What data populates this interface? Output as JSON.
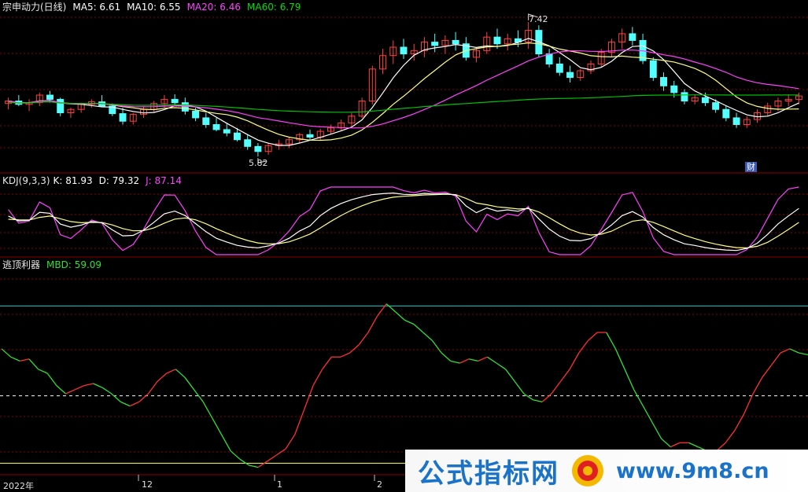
{
  "main_panel": {
    "title": "宗申动力(日线)",
    "ma5_label": "MA5: 6.61",
    "ma10_label": "MA10: 6.55",
    "ma20_label": "MA20: 6.46",
    "ma60_label": "MA60: 6.79",
    "high_marker": "7.42",
    "low_marker": "5.82",
    "finance_badge": "财"
  },
  "kdj_panel": {
    "title": "KDJ(9,3,3)",
    "k_label": "K: 81.93",
    "d_label": "D: 79.32",
    "j_label": "J: 87.14"
  },
  "indicator_panel": {
    "title": "逃顶利器",
    "mbd_label": "MBD: 59.09"
  },
  "x_axis": {
    "labels": [
      "2022年",
      "12",
      "1",
      "2"
    ]
  },
  "watermark": {
    "left_text": "公式指标网",
    "right_text": "www.9m8.cn"
  },
  "colors": {
    "up": "#ff4040",
    "down": "#54ffff",
    "ma5": "#ffffff",
    "ma10": "#ffff80",
    "ma20": "#ff40ff",
    "ma60": "#00c000",
    "mbd_up": "#ff3030",
    "mbd_down": "#30e030",
    "grid": "#8b0000"
  },
  "chart_data": [
    {
      "type": "candlestick",
      "title": "宗申动力(日线)",
      "high_annotation": 7.42,
      "low_annotation": 5.82,
      "ylim": [
        5.7,
        7.55
      ],
      "ohlc": [
        [
          6.45,
          6.52,
          6.38,
          6.48
        ],
        [
          6.48,
          6.55,
          6.42,
          6.44
        ],
        [
          6.44,
          6.5,
          6.36,
          6.46
        ],
        [
          6.46,
          6.58,
          6.42,
          6.55
        ],
        [
          6.55,
          6.6,
          6.46,
          6.5
        ],
        [
          6.5,
          6.52,
          6.3,
          6.34
        ],
        [
          6.34,
          6.4,
          6.28,
          6.38
        ],
        [
          6.38,
          6.46,
          6.34,
          6.44
        ],
        [
          6.44,
          6.5,
          6.4,
          6.47
        ],
        [
          6.47,
          6.55,
          6.41,
          6.42
        ],
        [
          6.42,
          6.45,
          6.3,
          6.33
        ],
        [
          6.33,
          6.4,
          6.2,
          6.24
        ],
        [
          6.24,
          6.34,
          6.2,
          6.32
        ],
        [
          6.32,
          6.42,
          6.28,
          6.38
        ],
        [
          6.38,
          6.48,
          6.34,
          6.45
        ],
        [
          6.45,
          6.55,
          6.4,
          6.5
        ],
        [
          6.5,
          6.56,
          6.42,
          6.46
        ],
        [
          6.46,
          6.52,
          6.32,
          6.36
        ],
        [
          6.36,
          6.4,
          6.24,
          6.28
        ],
        [
          6.28,
          6.34,
          6.16,
          6.2
        ],
        [
          6.2,
          6.28,
          6.12,
          6.14
        ],
        [
          6.14,
          6.22,
          6.06,
          6.1
        ],
        [
          6.1,
          6.16,
          6.0,
          6.02
        ],
        [
          6.02,
          6.08,
          5.9,
          5.94
        ],
        [
          5.94,
          5.98,
          5.82,
          5.88
        ],
        [
          5.88,
          5.98,
          5.84,
          5.95
        ],
        [
          5.95,
          6.02,
          5.9,
          5.97
        ],
        [
          5.97,
          6.05,
          5.92,
          6.02
        ],
        [
          6.02,
          6.1,
          5.98,
          6.08
        ],
        [
          6.08,
          6.14,
          6.02,
          6.05
        ],
        [
          6.05,
          6.15,
          6.02,
          6.12
        ],
        [
          6.12,
          6.2,
          6.08,
          6.16
        ],
        [
          6.16,
          6.26,
          6.12,
          6.22
        ],
        [
          6.22,
          6.34,
          6.18,
          6.3
        ],
        [
          6.3,
          6.52,
          6.28,
          6.48
        ],
        [
          6.48,
          6.9,
          6.44,
          6.86
        ],
        [
          6.86,
          7.1,
          6.8,
          7.02
        ],
        [
          7.02,
          7.2,
          6.92,
          7.12
        ],
        [
          7.12,
          7.22,
          6.98,
          7.04
        ],
        [
          7.04,
          7.16,
          6.96,
          7.08
        ],
        [
          7.08,
          7.24,
          7.0,
          7.18
        ],
        [
          7.18,
          7.28,
          7.06,
          7.14
        ],
        [
          7.14,
          7.26,
          7.04,
          7.2
        ],
        [
          7.2,
          7.3,
          7.08,
          7.16
        ],
        [
          7.16,
          7.24,
          6.96,
          7.0
        ],
        [
          7.0,
          7.12,
          6.94,
          7.08
        ],
        [
          7.08,
          7.3,
          7.04,
          7.24
        ],
        [
          7.24,
          7.34,
          7.1,
          7.16
        ],
        [
          7.16,
          7.28,
          7.08,
          7.22
        ],
        [
          7.22,
          7.32,
          7.12,
          7.18
        ],
        [
          7.18,
          7.42,
          7.1,
          7.32
        ],
        [
          7.32,
          7.38,
          7.0,
          7.04
        ],
        [
          7.04,
          7.1,
          6.88,
          6.92
        ],
        [
          6.92,
          7.0,
          6.78,
          6.82
        ],
        [
          6.82,
          6.9,
          6.7,
          6.76
        ],
        [
          6.76,
          6.86,
          6.72,
          6.84
        ],
        [
          6.84,
          6.96,
          6.8,
          6.92
        ],
        [
          6.92,
          7.1,
          6.88,
          7.06
        ],
        [
          7.06,
          7.22,
          7.0,
          7.18
        ],
        [
          7.18,
          7.34,
          7.1,
          7.28
        ],
        [
          7.28,
          7.36,
          7.14,
          7.2
        ],
        [
          7.2,
          7.28,
          6.92,
          6.96
        ],
        [
          6.96,
          7.0,
          6.72,
          6.76
        ],
        [
          6.76,
          6.82,
          6.6,
          6.66
        ],
        [
          6.66,
          6.72,
          6.52,
          6.58
        ],
        [
          6.58,
          6.62,
          6.44,
          6.48
        ],
        [
          6.48,
          6.56,
          6.44,
          6.52
        ],
        [
          6.52,
          6.58,
          6.42,
          6.46
        ],
        [
          6.46,
          6.5,
          6.34,
          6.38
        ],
        [
          6.38,
          6.42,
          6.24,
          6.28
        ],
        [
          6.28,
          6.34,
          6.16,
          6.2
        ],
        [
          6.2,
          6.3,
          6.16,
          6.26
        ],
        [
          6.26,
          6.38,
          6.22,
          6.34
        ],
        [
          6.34,
          6.46,
          6.3,
          6.42
        ],
        [
          6.42,
          6.52,
          6.36,
          6.48
        ],
        [
          6.48,
          6.56,
          6.42,
          6.5
        ],
        [
          6.5,
          6.58,
          6.44,
          6.54
        ]
      ],
      "ma5_last": 6.61,
      "ma10_last": 6.55,
      "ma20_last": 6.46,
      "ma60_last": 6.79
    },
    {
      "type": "line",
      "title": "KDJ(9,3,3)",
      "series_names": [
        "K",
        "D",
        "J"
      ],
      "last": {
        "K": 81.93,
        "D": 79.32,
        "J": 87.14
      },
      "ylim": [
        0,
        100
      ]
    },
    {
      "type": "line",
      "title": "逃顶利器",
      "series_name": "MBD",
      "last": 59.09,
      "ylim": [
        0,
        100
      ],
      "values": [
        62,
        58,
        56,
        57,
        52,
        50,
        44,
        40,
        42,
        44,
        45,
        43,
        40,
        36,
        34,
        36,
        40,
        46,
        50,
        52,
        48,
        42,
        36,
        28,
        20,
        12,
        8,
        5,
        4,
        7,
        10,
        13,
        20,
        32,
        44,
        52,
        58,
        58,
        60,
        64,
        70,
        78,
        84,
        80,
        76,
        74,
        70,
        66,
        60,
        56,
        55,
        57,
        56,
        58,
        55,
        52,
        46,
        40,
        37,
        36,
        40,
        46,
        52,
        60,
        66,
        70,
        70,
        62,
        52,
        42,
        34,
        26,
        18,
        14,
        16,
        16,
        14,
        12,
        12,
        16,
        22,
        30,
        40,
        48,
        54,
        60,
        62,
        60,
        59.09
      ],
      "hlines": [
        {
          "y": 83,
          "style": "solid"
        },
        {
          "y": 39,
          "style": "dashed"
        },
        {
          "y": 6,
          "style": "solid"
        }
      ]
    }
  ]
}
